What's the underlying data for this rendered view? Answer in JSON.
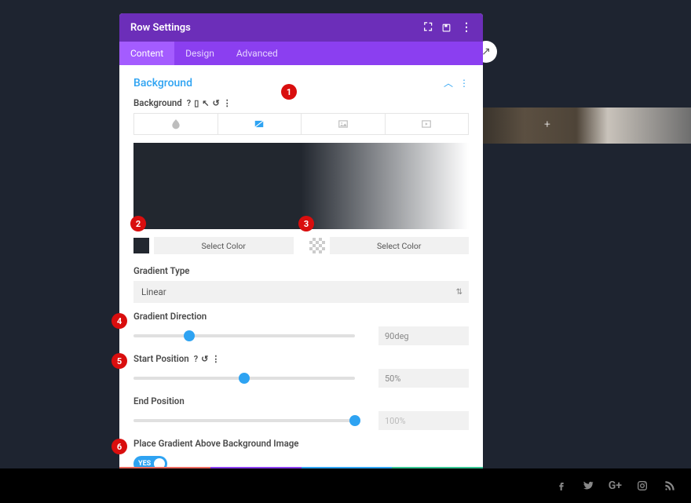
{
  "modal": {
    "title": "Row Settings",
    "tabs": [
      "Content",
      "Design",
      "Advanced"
    ],
    "active_tab": 0
  },
  "section": {
    "title": "Background",
    "field_label": "Background",
    "bg_tabs": [
      "color",
      "gradient",
      "image",
      "video"
    ],
    "active_bg_tab": 1
  },
  "colors": {
    "c1_btn": "Select Color",
    "c2_btn": "Select Color",
    "c1_hex": "#22272f",
    "c2_hex": "transparent"
  },
  "gradient_type": {
    "label": "Gradient Type",
    "value": "Linear"
  },
  "gradient_direction": {
    "label": "Gradient Direction",
    "value": "90deg",
    "percent": 25
  },
  "start_position": {
    "label": "Start Position",
    "value": "50%",
    "percent": 50
  },
  "end_position": {
    "label": "End Position",
    "value": "100%",
    "percent": 100
  },
  "place_above": {
    "label": "Place Gradient Above Background Image",
    "value": "YES"
  },
  "annotations": [
    "1",
    "2",
    "3",
    "4",
    "5",
    "6"
  ]
}
